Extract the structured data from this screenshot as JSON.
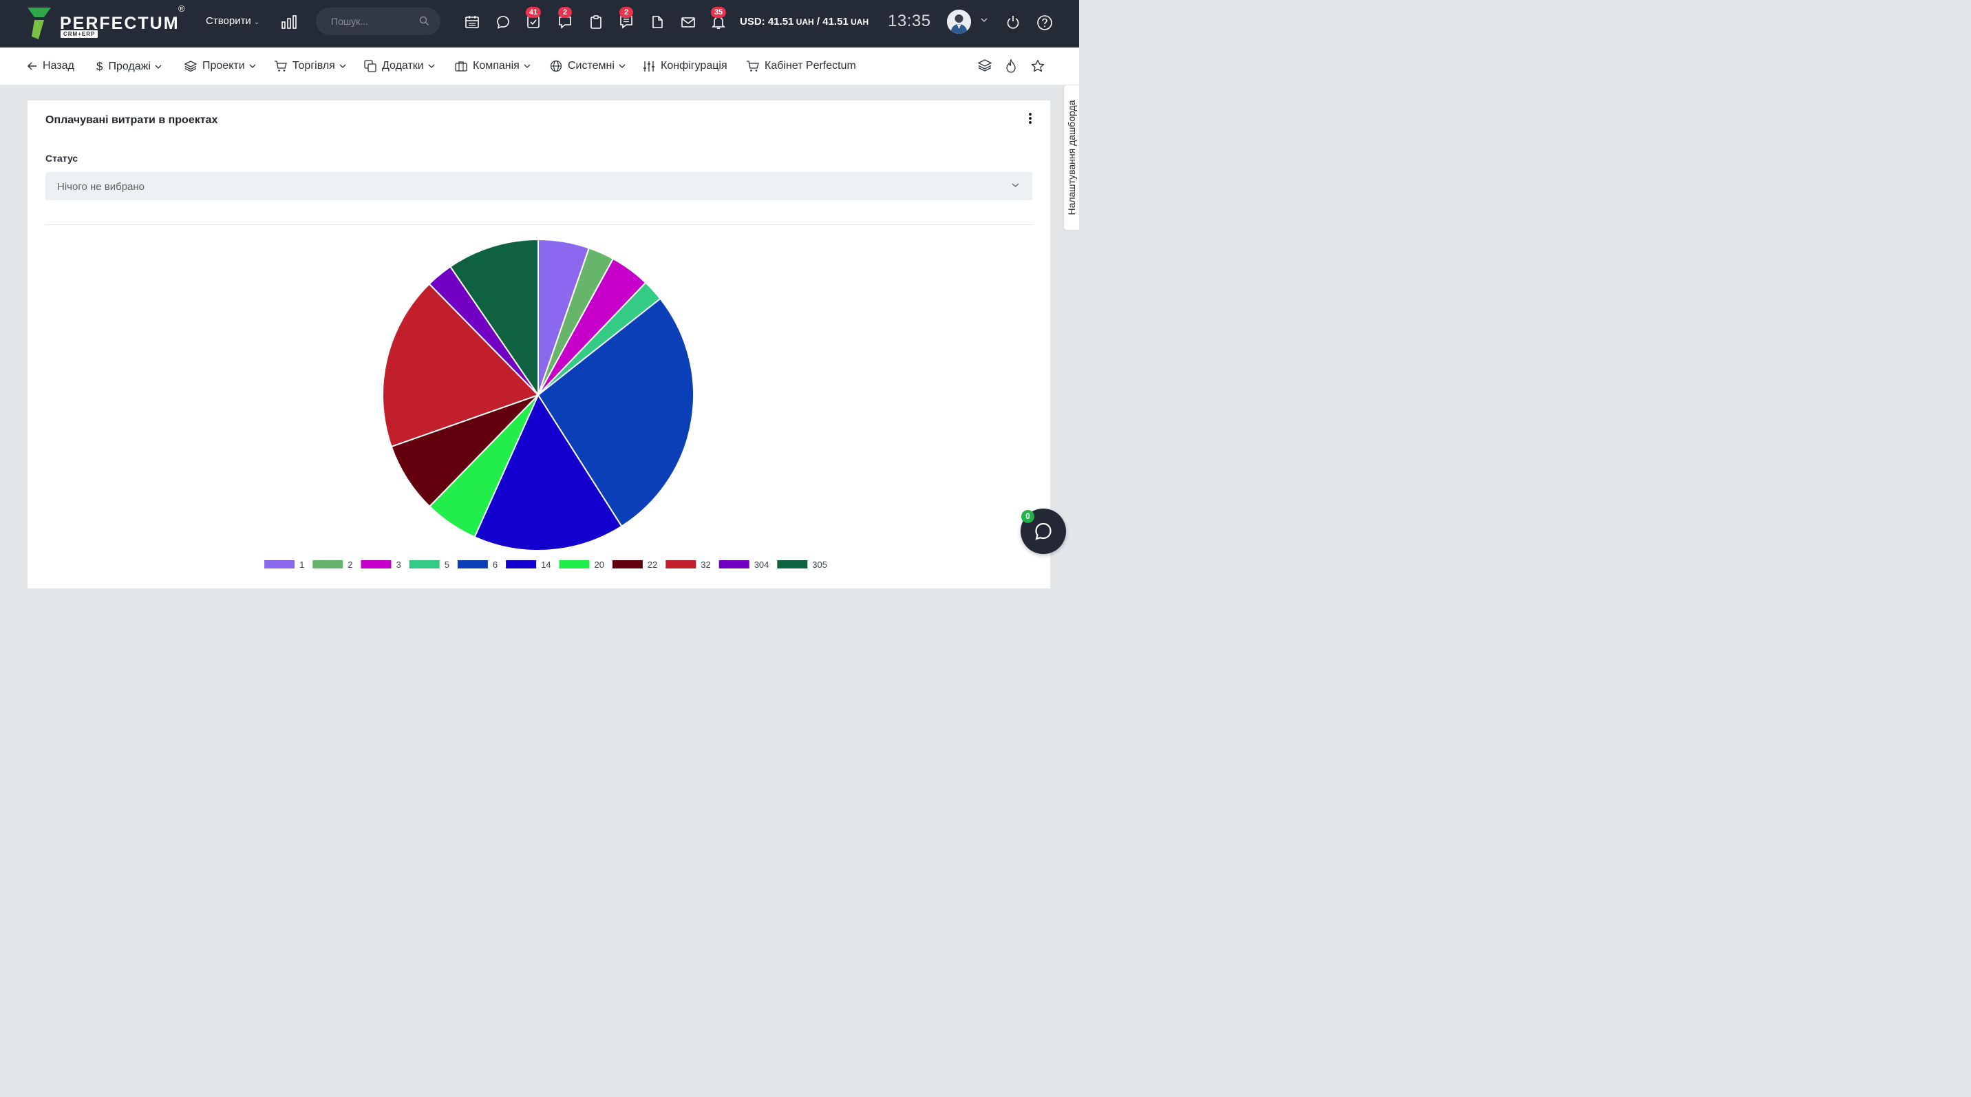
{
  "header": {
    "logo_text": "PERFECTUM",
    "logo_reg": "®",
    "logo_sub": "CRM+ERP",
    "create_label": "Створити",
    "search_placeholder": "Пошук...",
    "badges": {
      "tasks": "41",
      "discussions": "2",
      "notes": "2",
      "notifications": "35"
    },
    "currency": {
      "prefix": "USD: ",
      "v1": "41.51",
      "u1": " UAH",
      "sep": " / ",
      "v2": "41.51",
      "u2": " UAH"
    },
    "time": "13:35"
  },
  "nav": {
    "back": "Назад",
    "sales": "Продажі",
    "projects": "Проекти",
    "trade": "Торгівля",
    "addons": "Додатки",
    "company": "Компанія",
    "system": "Системні",
    "config": "Конфігурація",
    "cabinet": "Кабінет Perfectum"
  },
  "card": {
    "title": "Оплачувані витрати в проектах",
    "status_label": "Статус",
    "status_value": "Нічого не вибрано"
  },
  "side_tab": "Налаштування дашборда",
  "chat": {
    "badge": "0"
  },
  "chart_data": {
    "type": "pie",
    "title": "",
    "categories": [
      "1",
      "2",
      "3",
      "5",
      "6",
      "14",
      "20",
      "22",
      "32",
      "304",
      "305"
    ],
    "values": [
      5.5,
      2.8,
      4.3,
      2.3,
      27.6,
      16.3,
      5.8,
      7.6,
      18.7,
      2.9,
      9.9
    ],
    "colors": [
      "#8b69ee",
      "#66b56b",
      "#c700c9",
      "#34cb85",
      "#0b3fb7",
      "#1300cf",
      "#22ee4b",
      "#62000e",
      "#c21f2d",
      "#7100c2",
      "#0e6240"
    ],
    "legend": "bottom"
  }
}
